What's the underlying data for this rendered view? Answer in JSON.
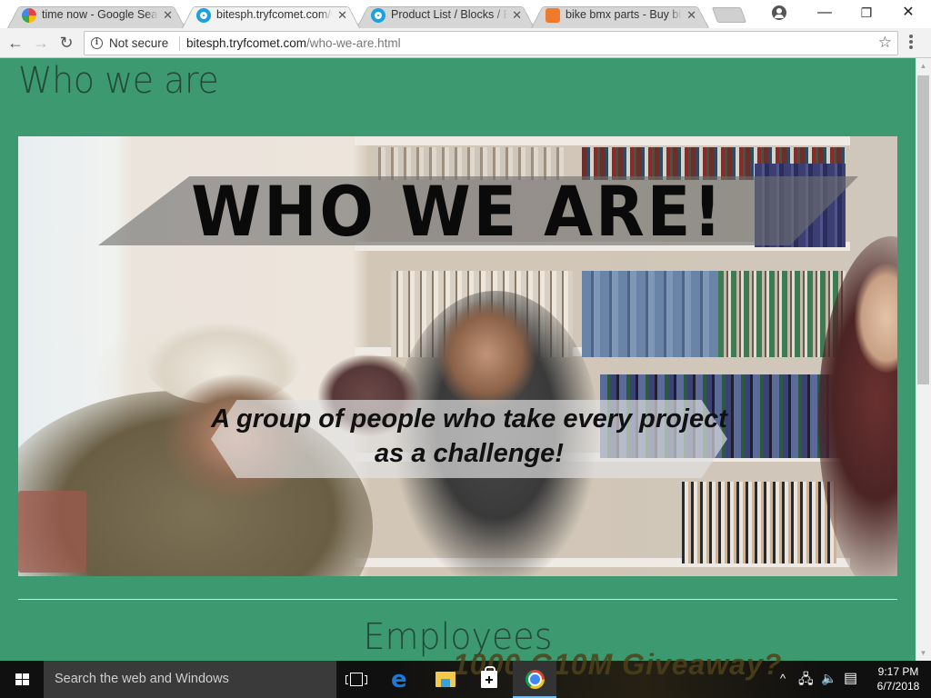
{
  "browser": {
    "tabs": [
      {
        "title": "time now - Google Search",
        "favicon": "google-g-icon",
        "active": false
      },
      {
        "title": "bitesph.tryfcomet.com/who-we-are.html",
        "favicon": "comet-icon",
        "active": true
      },
      {
        "title": "Product List / Blocks / Elements",
        "favicon": "comet-icon",
        "active": false
      },
      {
        "title": "bike bmx parts - Buy bike bmx parts",
        "favicon": "aliexpress-icon",
        "active": false
      }
    ],
    "close_glyph": "✕",
    "window_controls": {
      "minimize": "—",
      "restore": "❐",
      "close": "✕"
    },
    "nav": {
      "back": "←",
      "forward": "→",
      "reload": "↻"
    },
    "address": {
      "security_label": "Not secure",
      "url_host": "bitesph.tryfcomet.com",
      "url_path": "/who-we-are.html",
      "bookmark_glyph": "☆"
    }
  },
  "page": {
    "title": "Who we are",
    "banner": {
      "headline": "WHO WE ARE!",
      "tagline": "A group of people who take every project as a challenge!"
    },
    "section_title": "Employees"
  },
  "colors": {
    "page_background": "#3d9970",
    "heading_text": "#244a37",
    "taskbar": "#101010"
  },
  "taskbar": {
    "search_placeholder": "Search the web and Windows",
    "pinned_apps": [
      "task-view",
      "edge",
      "file-explorer",
      "store",
      "chrome"
    ],
    "background_ghost_text": "1000 G10M Giveaway?",
    "tray": {
      "chevron": "^",
      "network": "🖧",
      "volume": "🔈",
      "notifications": "▤"
    },
    "time": "9:17 PM",
    "date": "6/7/2018"
  }
}
